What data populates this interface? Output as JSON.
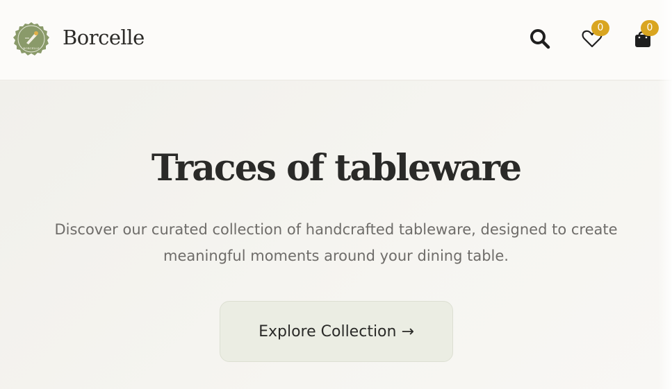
{
  "header": {
    "brand": "Borcelle",
    "logo_text": "BORCELLE",
    "icons": {
      "search": "search-icon",
      "wishlist": "heart-icon",
      "cart": "shopping-bag-icon"
    },
    "wishlist_count": "0",
    "cart_count": "0"
  },
  "hero": {
    "title": "Traces of tableware",
    "subtitle": "Discover our curated collection of handcrafted tableware, designed to create meaningful moments around your dining table.",
    "cta_label": "Explore Collection →"
  },
  "colors": {
    "badge": "#d9a520",
    "logo_green": "#8a9a6a",
    "cta_bg": "#ebede3",
    "text_dark": "#2a2a28"
  }
}
